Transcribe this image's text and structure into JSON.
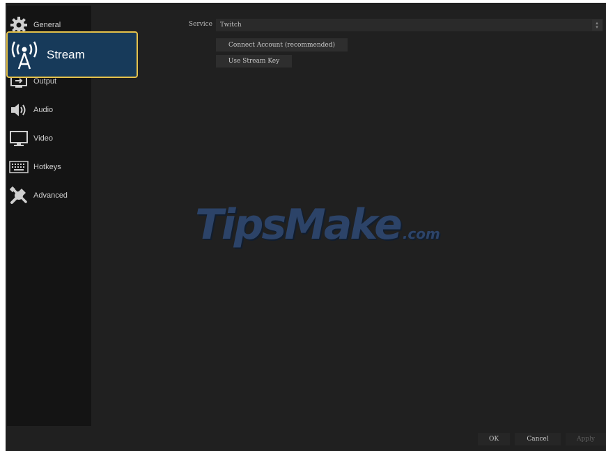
{
  "sidebar": {
    "items": [
      {
        "label": "General",
        "icon": "gear-icon"
      },
      {
        "label": "Stream",
        "icon": "broadcast-tower-icon"
      },
      {
        "label": "Output",
        "icon": "output-monitor-icon"
      },
      {
        "label": "Audio",
        "icon": "speaker-icon"
      },
      {
        "label": "Video",
        "icon": "monitor-icon"
      },
      {
        "label": "Hotkeys",
        "icon": "keyboard-icon"
      },
      {
        "label": "Advanced",
        "icon": "tools-icon"
      }
    ],
    "selected": "Stream"
  },
  "stream_settings": {
    "service_label": "Service",
    "service_value": "Twitch",
    "connect_account_label": "Connect Account (recommended)",
    "use_stream_key_label": "Use Stream Key"
  },
  "footer": {
    "ok_label": "OK",
    "cancel_label": "Cancel",
    "apply_label": "Apply"
  },
  "watermark": {
    "main": "TipsMake",
    "suffix": ".com"
  },
  "colors": {
    "window_bg": "#202020",
    "sidebar_bg": "#141414",
    "highlight_bg": "#173a5a",
    "highlight_border": "#e6c24a"
  }
}
